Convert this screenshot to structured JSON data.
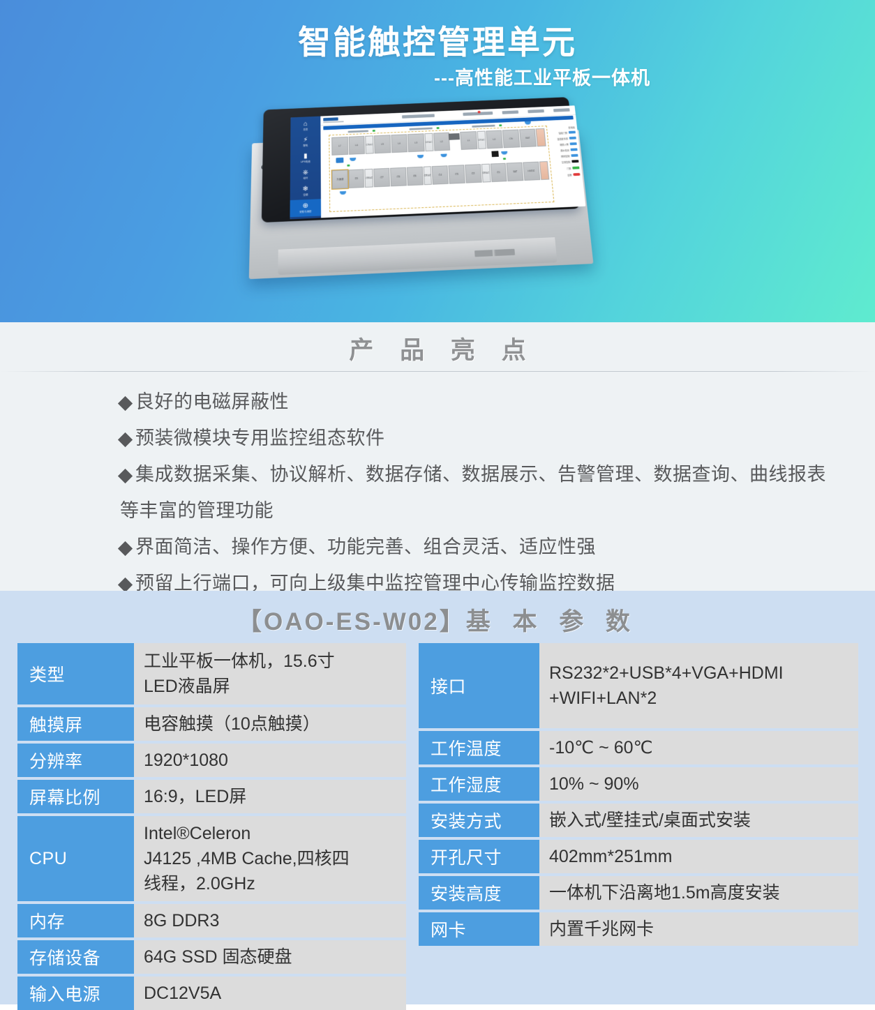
{
  "header": {
    "title": "智能触控管理单元",
    "subtitle": "---高性能工业平板一体机",
    "gradient_from": "#4a8ddb",
    "gradient_to": "#5febcf"
  },
  "product_image": {
    "alt": "工业平板一体机",
    "screen_nav": [
      {
        "icon": "home-icon",
        "glyph": "⌂",
        "label": "总览"
      },
      {
        "icon": "power-icon",
        "glyph": "⚡",
        "label": "配电"
      },
      {
        "icon": "battery-icon",
        "glyph": "▬",
        "label": "UPS电池"
      },
      {
        "icon": "cooling-icon",
        "glyph": "⎈",
        "label": "动环"
      },
      {
        "icon": "snowflake-icon",
        "glyph": "❄",
        "label": "空调"
      },
      {
        "icon": "shield-icon",
        "glyph": "⊕",
        "label": "安防与消防"
      }
    ],
    "rack_top": [
      "L7",
      "L6",
      "CRAC",
      "L5",
      "L4",
      "L3",
      "CRAC",
      "L2",
      "L1",
      "CRAC",
      "L0",
      "CN",
      "BAT"
    ],
    "rack_bottom": [
      "冷通道",
      "C9",
      "CRAC",
      "C7",
      "C6",
      "C5",
      "CRAC",
      "C4",
      "C3",
      "C2",
      "CRAC",
      "C1",
      "BAT",
      "HVDC"
    ],
    "legend": [
      "配电柜",
      "智能门禁",
      "温湿度传感",
      "烟感火警",
      "漏水检测",
      "照明控制",
      "空调控制",
      "门禁",
      "告警"
    ]
  },
  "highlights": {
    "title": "产 品 亮 点",
    "items": [
      "良好的电磁屏蔽性",
      "预装微模块专用监控组态软件",
      "集成数据采集、协议解析、数据存储、数据展示、告警管理、数据查询、曲线报表等丰富的管理功能",
      "界面简洁、操作方便、功能完善、组合灵活、适应性强",
      "预留上行端口，可向上级集中监控管理中心传输监控数据"
    ]
  },
  "specs": {
    "title_model": "【OAO-ES-W02】",
    "title_cn": "基 本 参 数",
    "accent_color": "#4d9ee0",
    "left_table": [
      {
        "key": "类型",
        "value": "工业平板一体机，15.6寸\nLED液晶屏"
      },
      {
        "key": "触摸屏",
        "value": "电容触摸（10点触摸）"
      },
      {
        "key": "分辨率",
        "value": "1920*1080"
      },
      {
        "key": "屏幕比例",
        "value": "16:9，LED屏"
      },
      {
        "key": "CPU",
        "value": "Intel®Celeron\nJ4125 ,4MB Cache,四核四\n线程，2.0GHz"
      },
      {
        "key": "内存",
        "value": "8G DDR3"
      },
      {
        "key": "存储设备",
        "value": "64G SSD 固态硬盘"
      },
      {
        "key": "输入电源",
        "value": "DC12V5A"
      }
    ],
    "right_table": [
      {
        "key": "接口",
        "value": "RS232*2+USB*4+VGA+HDMI\n+WIFI+LAN*2"
      },
      {
        "key": "工作温度",
        "value": "-10℃ ~ 60℃"
      },
      {
        "key": "工作湿度",
        "value": "10% ~ 90%"
      },
      {
        "key": "安装方式",
        "value": "嵌入式/壁挂式/桌面式安装"
      },
      {
        "key": "开孔尺寸",
        "value": "402mm*251mm"
      },
      {
        "key": "安装高度",
        "value": "一体机下沿离地1.5m高度安装"
      },
      {
        "key": "网卡",
        "value": "内置千兆网卡"
      }
    ]
  }
}
